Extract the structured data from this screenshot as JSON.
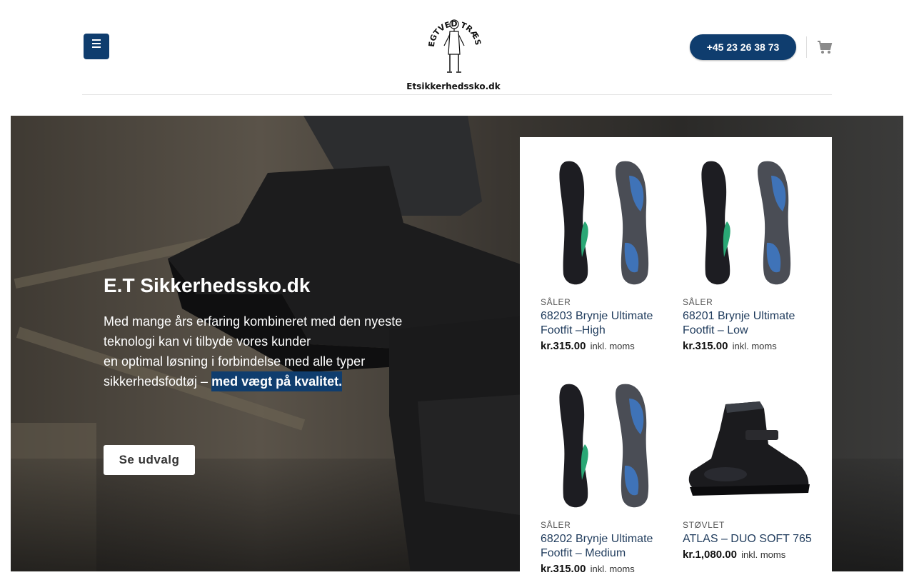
{
  "header": {
    "logo_arc_text": "EGTVED TRÆSKO",
    "logo_text": "Etsikkerhedssko.dk",
    "phone": "+45 23 26 38 73",
    "menu_icon": "hamburger-icon",
    "cart_icon": "cart-icon"
  },
  "hero": {
    "title": "E.T Sikkerhedssko.dk",
    "text_line1": "Med mange års erfaring kombineret med den nyeste",
    "text_line2": "teknologi kan vi tilbyde vores kunder",
    "text_line3": "en optimal løsning i forbindelse med alle typer",
    "text_line4": "sikkerhedsfodtøj – ",
    "text_highlight": "med vægt på kvalitet.",
    "button": "Se udvalg"
  },
  "products": [
    {
      "category": "SÅLER",
      "name": "68203 Brynje Ultimate Footfit –High",
      "currency": "kr.",
      "price": "315.00",
      "tax": "inkl. moms"
    },
    {
      "category": "SÅLER",
      "name": "68201 Brynje Ultimate Footfit – Low",
      "currency": "kr.",
      "price": "315.00",
      "tax": "inkl. moms"
    },
    {
      "category": "SÅLER",
      "name": "68202 Brynje Ultimate Footfit – Medium",
      "currency": "kr.",
      "price": "315.00",
      "tax": "inkl. moms"
    },
    {
      "category": "STØVLET",
      "name": "ATLAS – DUO SOFT 765",
      "currency": "kr.",
      "price": "1,080.00",
      "tax": "inkl. moms"
    }
  ],
  "colors": {
    "brand": "#0f3d6e",
    "insole_blue": "#3f73b8",
    "insole_green": "#2aa775"
  }
}
